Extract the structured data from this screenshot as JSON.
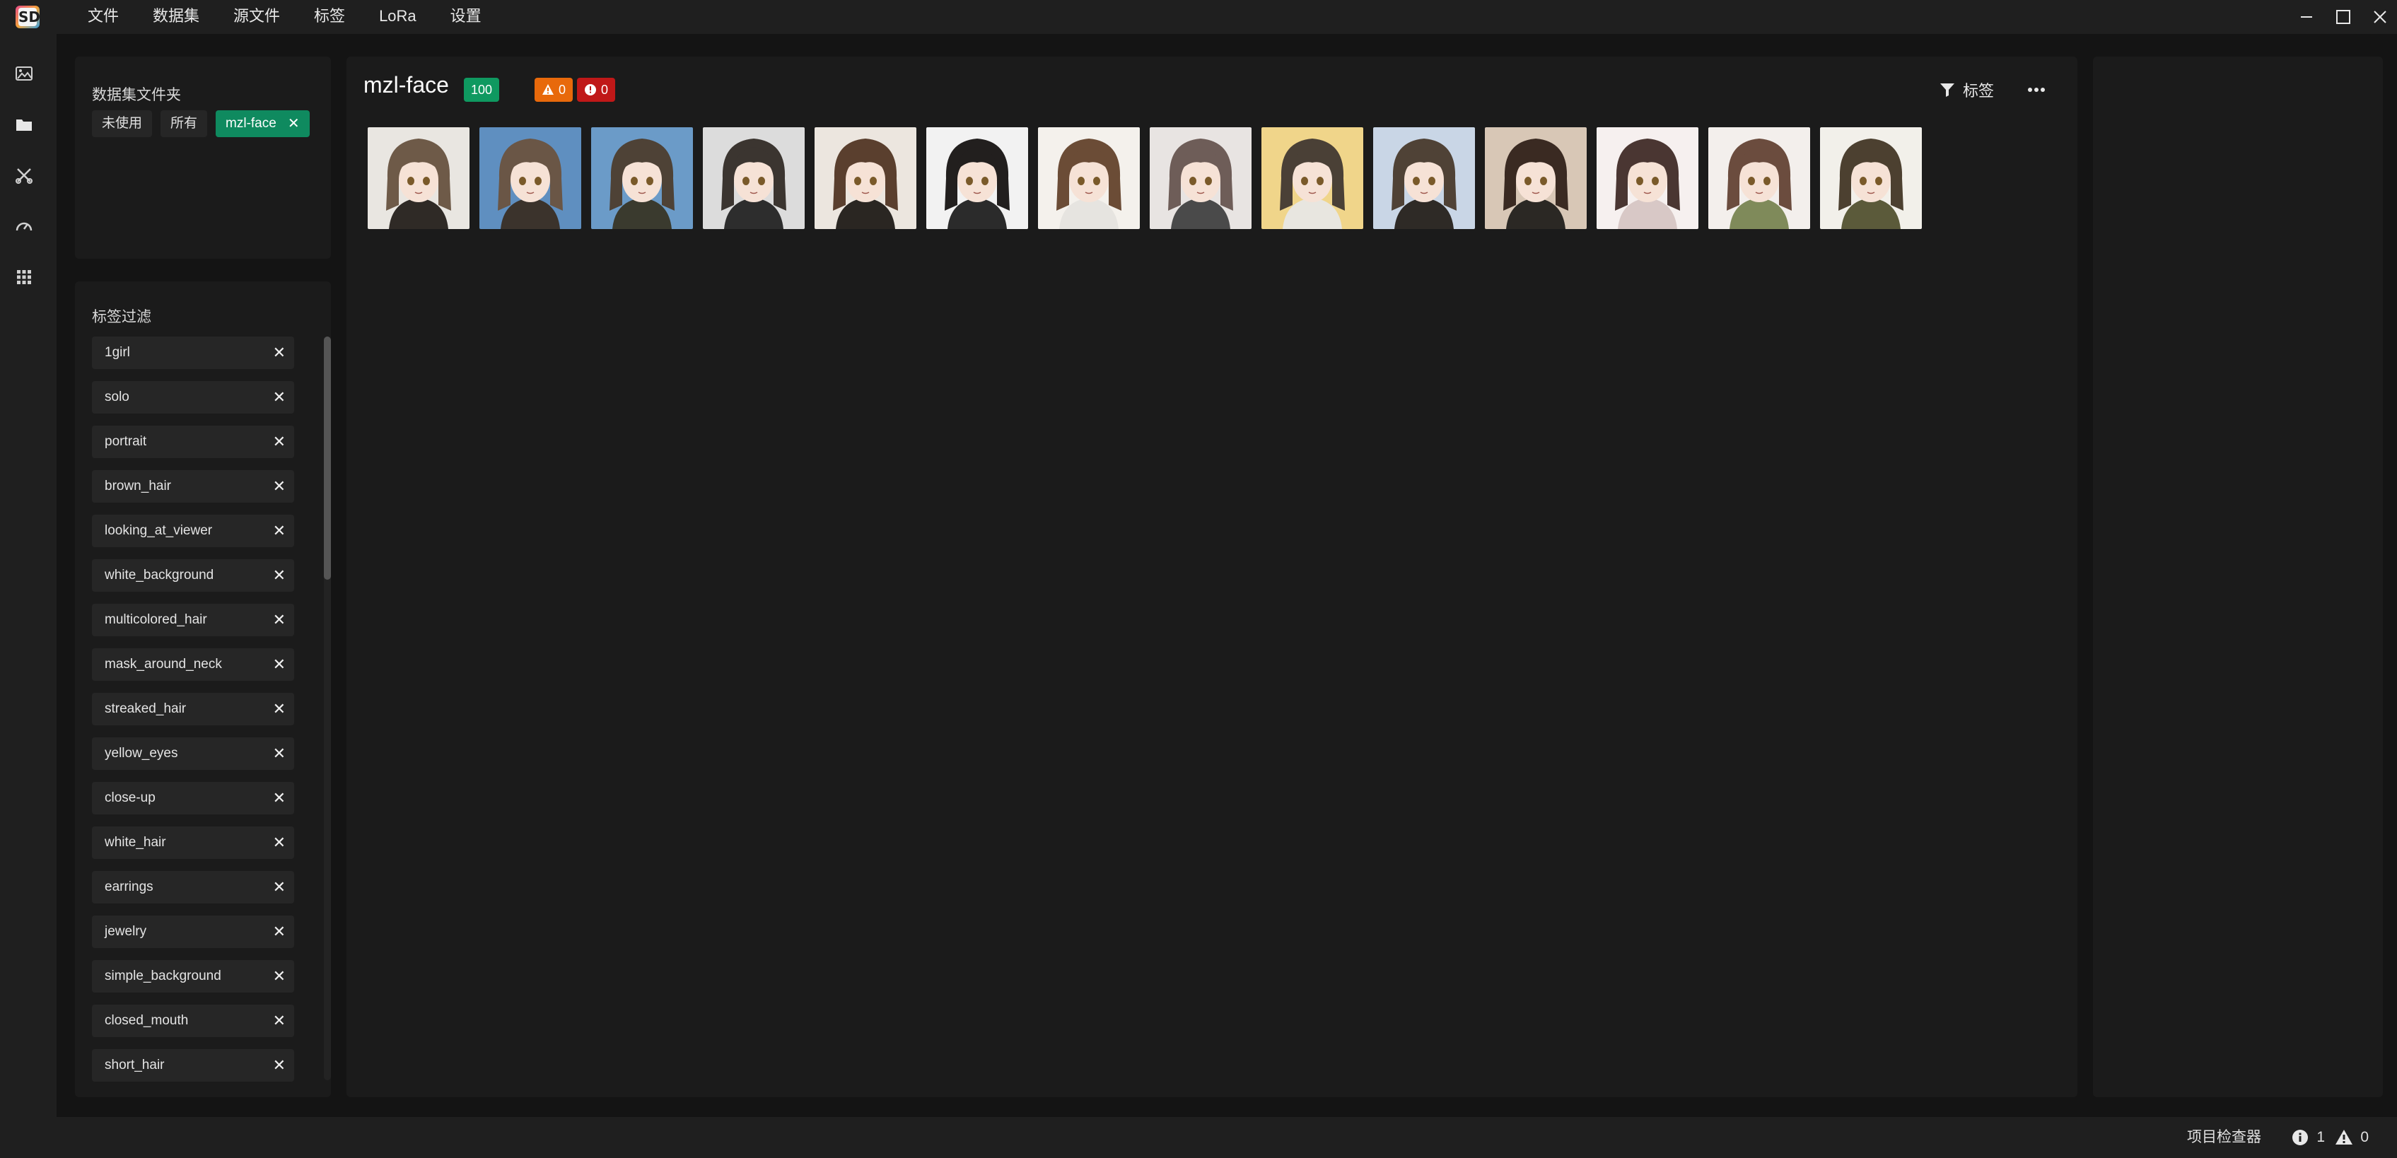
{
  "app": {
    "logo_text": "SD"
  },
  "menu": [
    "文件",
    "数据集",
    "源文件",
    "标签",
    "LoRa",
    "设置"
  ],
  "window_controls": [
    "minimize-icon",
    "maximize-icon",
    "close-icon"
  ],
  "activity_bar": [
    "images-icon",
    "folder-icon",
    "tools-icon",
    "speedometer-icon",
    "apps-grid-icon"
  ],
  "dataset_folders": {
    "title": "数据集文件夹",
    "chips": [
      {
        "label": "未使用",
        "active": false
      },
      {
        "label": "所有",
        "active": false
      },
      {
        "label": "mzl-face",
        "active": true,
        "close": "✕"
      }
    ]
  },
  "tag_filter": {
    "title": "标签过滤",
    "remove_symbol": "✕",
    "tags": [
      "1girl",
      "solo",
      "portrait",
      "brown_hair",
      "looking_at_viewer",
      "white_background",
      "multicolored_hair",
      "mask_around_neck",
      "streaked_hair",
      "yellow_eyes",
      "close-up",
      "white_hair",
      "earrings",
      "jewelry",
      "simple_background",
      "closed_mouth",
      "short_hair"
    ]
  },
  "dataset": {
    "name": "mzl-face",
    "count": "100",
    "warnings": "0",
    "errors": "0",
    "tag_button": "标签",
    "more_icon": "more-horizontal-icon",
    "images": [
      {
        "bg": "#e9e6e1",
        "hair": "#6e5a48",
        "outfit": "#2f2a26"
      },
      {
        "bg": "#5f8fc0",
        "hair": "#6a5646",
        "outfit": "#3b332c"
      },
      {
        "bg": "#6b9bc8",
        "hair": "#4e4236",
        "outfit": "#3a3a2e"
      },
      {
        "bg": "#dcdcdc",
        "hair": "#3b3530",
        "outfit": "#2d2d2d"
      },
      {
        "bg": "#ece6df",
        "hair": "#5a3f2e",
        "outfit": "#2a2622"
      },
      {
        "bg": "#f2f2f2",
        "hair": "#221f1e",
        "outfit": "#2b2b2b"
      },
      {
        "bg": "#f4f1ec",
        "hair": "#6b4c36",
        "outfit": "#e6e4e0"
      },
      {
        "bg": "#e8e4e2",
        "hair": "#6e5d58",
        "outfit": "#4a4a4a"
      },
      {
        "bg": "#f0d58a",
        "hair": "#4a4036",
        "outfit": "#e8e6e0"
      },
      {
        "bg": "#c9d6e6",
        "hair": "#4f4236",
        "outfit": "#2e2a26"
      },
      {
        "bg": "#d8c7b6",
        "hair": "#3a2a22",
        "outfit": "#2b2824"
      },
      {
        "bg": "#f6f0ef",
        "hair": "#4a3632",
        "outfit": "#d8c8c6"
      },
      {
        "bg": "#f3efec",
        "hair": "#6b4c3e",
        "outfit": "#7f8a5a"
      },
      {
        "bg": "#f2f0ea",
        "hair": "#4c4030",
        "outfit": "#5b5a3a"
      }
    ]
  },
  "status_bar": {
    "inspector_label": "项目检查器",
    "info_count": "1",
    "warning_count": "0"
  },
  "colors": {
    "accent_green": "#0f9960",
    "warning_orange": "#e8690b",
    "error_red": "#c01818"
  }
}
